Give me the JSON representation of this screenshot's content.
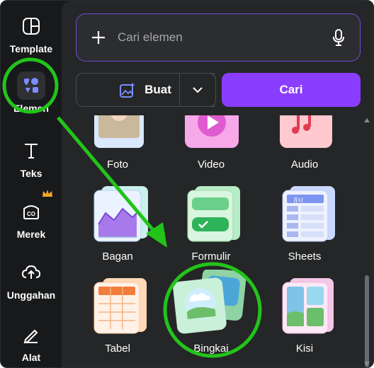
{
  "sidebar": {
    "items": [
      {
        "label": "Template",
        "icon": "template-icon"
      },
      {
        "label": "Elemen",
        "icon": "elements-icon"
      },
      {
        "label": "Teks",
        "icon": "text-icon"
      },
      {
        "label": "Merek",
        "icon": "brand-icon"
      },
      {
        "label": "Unggahan",
        "icon": "upload-icon"
      },
      {
        "label": "Alat",
        "icon": "tools-icon"
      }
    ]
  },
  "search": {
    "placeholder": "Cari elemen"
  },
  "actions": {
    "buat_label": "Buat",
    "cari_label": "Cari"
  },
  "grid": {
    "items": [
      {
        "label": "Foto"
      },
      {
        "label": "Video"
      },
      {
        "label": "Audio"
      },
      {
        "label": "Bagan"
      },
      {
        "label": "Formulir"
      },
      {
        "label": "Sheets"
      },
      {
        "label": "Tabel"
      },
      {
        "label": "Bingkai"
      },
      {
        "label": "Kisi"
      }
    ]
  },
  "colors": {
    "accent": "#8b3dff",
    "highlight": "#22c41a"
  }
}
